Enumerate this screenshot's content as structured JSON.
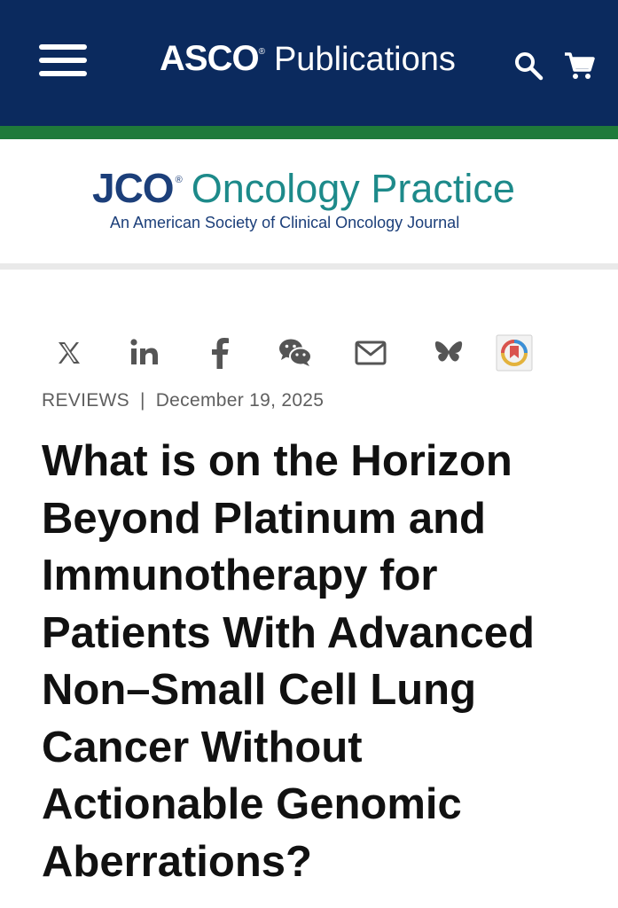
{
  "header": {
    "brand_name": "ASCO",
    "brand_reg": "®",
    "brand_suffix": "Publications",
    "icons": [
      "menu-icon",
      "search-icon",
      "cart-icon"
    ],
    "colors": {
      "background": "#0b2a5e",
      "accent_stripe": "#1f7a3a"
    }
  },
  "journal": {
    "short": "JCO",
    "reg": "®",
    "name": "Oncology Practice",
    "subtitle": "An American Society of Clinical Oncology Journal",
    "colors": {
      "primary": "#1c3f7a",
      "secondary": "#1d8a8a"
    }
  },
  "share_icons": [
    "x-icon",
    "linkedin-icon",
    "facebook-icon",
    "wechat-icon",
    "email-icon",
    "bluesky-icon",
    "readcube-icon"
  ],
  "article": {
    "category": "REVIEWS",
    "separator": "|",
    "date": "December 19, 2025",
    "title": "What is on the Horizon Beyond Platinum and Immunotherapy for Patients With Advanced Non–Small Cell Lung Cancer Without Actionable Genomic Aberrations?"
  }
}
